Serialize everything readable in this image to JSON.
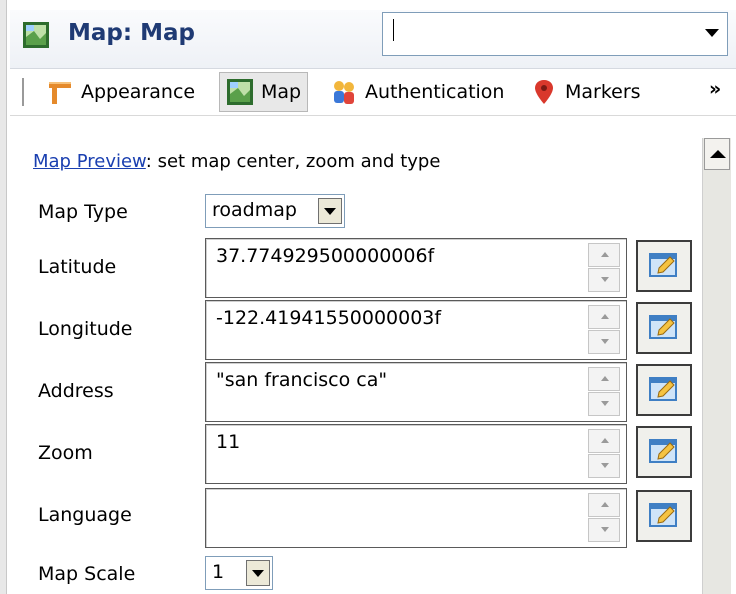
{
  "header": {
    "title": "Map: Map",
    "icon": "map-icon",
    "combo_value": ""
  },
  "tabs": [
    {
      "label": "Appearance",
      "icon": "appearance-icon",
      "active": false
    },
    {
      "label": "Map",
      "icon": "map-icon",
      "active": true
    },
    {
      "label": "Authentication",
      "icon": "authentication-icon",
      "active": false
    },
    {
      "label": "Markers",
      "icon": "marker-pin-icon",
      "active": false
    }
  ],
  "more_tabs": "»",
  "preview": {
    "link": "Map Preview",
    "rest": ": set map center, zoom and type"
  },
  "fields": {
    "map_type": {
      "label": "Map Type",
      "value": "roadmap"
    },
    "latitude": {
      "label": "Latitude",
      "value": "37.774929500000006f"
    },
    "longitude": {
      "label": "Longitude",
      "value": "-122.41941550000003f"
    },
    "address": {
      "label": "Address",
      "value": "\"san francisco ca\""
    },
    "zoom": {
      "label": "Zoom",
      "value": "11"
    },
    "language": {
      "label": "Language",
      "value": ""
    },
    "map_scale": {
      "label": "Map Scale",
      "value": "1"
    }
  },
  "colors": {
    "title": "#1f3a74",
    "link": "#1a3fb0"
  }
}
